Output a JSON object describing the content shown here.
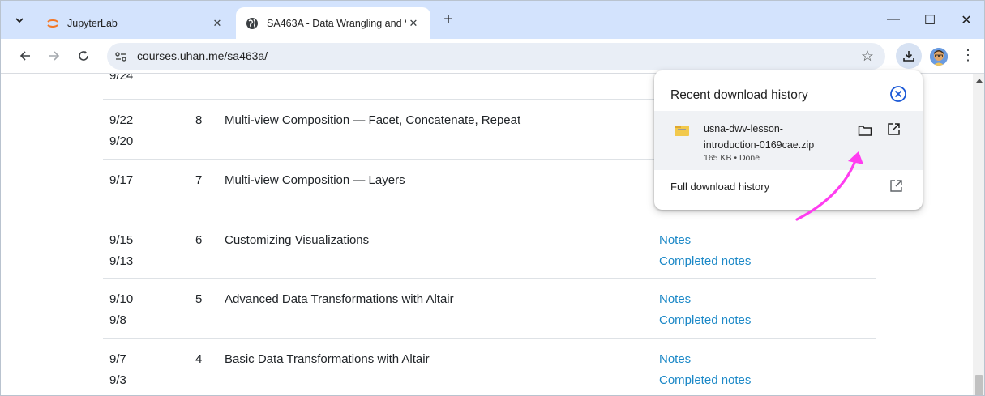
{
  "browser": {
    "tabs": [
      {
        "title": "JupyterLab",
        "active": false,
        "favicon": "jupyter-icon"
      },
      {
        "title": "SA463A - Data Wrangling and V",
        "active": true,
        "favicon": "globe-icon"
      }
    ],
    "new_tab": "+",
    "window_controls": {
      "minimize": "—",
      "maximize": "☐",
      "close": "✕"
    },
    "address": "courses.uhan.me/sa463a/"
  },
  "schedule": {
    "rows": [
      {
        "dates": [
          "9/24"
        ],
        "number": "",
        "topic": "",
        "links": []
      },
      {
        "dates": [
          "9/22",
          "9/20"
        ],
        "number": "8",
        "topic": "Multi-view Composition — Facet, Concatenate, Repeat",
        "links": []
      },
      {
        "dates": [
          "9/17"
        ],
        "number": "7",
        "topic": "Multi-view Composition — Layers",
        "links": []
      },
      {
        "dates": [
          "9/15",
          "9/13"
        ],
        "number": "6",
        "topic": "Customizing Visualizations",
        "links": [
          "Notes",
          "Completed notes"
        ]
      },
      {
        "dates": [
          "9/10",
          "9/8"
        ],
        "number": "5",
        "topic": "Advanced Data Transformations with Altair",
        "links": [
          "Notes",
          "Completed notes"
        ]
      },
      {
        "dates": [
          "9/7",
          "9/3"
        ],
        "number": "4",
        "topic": "Basic Data Transformations with Altair",
        "links": [
          "Notes",
          "Completed notes"
        ]
      }
    ]
  },
  "download_bubble": {
    "title": "Recent download history",
    "item": {
      "name_line1": "usna-dwv-lesson-",
      "name_line2": "introduction-0169cae.zip",
      "status": "165 KB • Done"
    },
    "full_history": "Full download history"
  },
  "colors": {
    "accent": "#1b88c7",
    "tabstrip": "#d3e3fd",
    "annotation_arrow": "#ff3df0",
    "close_ring": "#1a58d6"
  }
}
